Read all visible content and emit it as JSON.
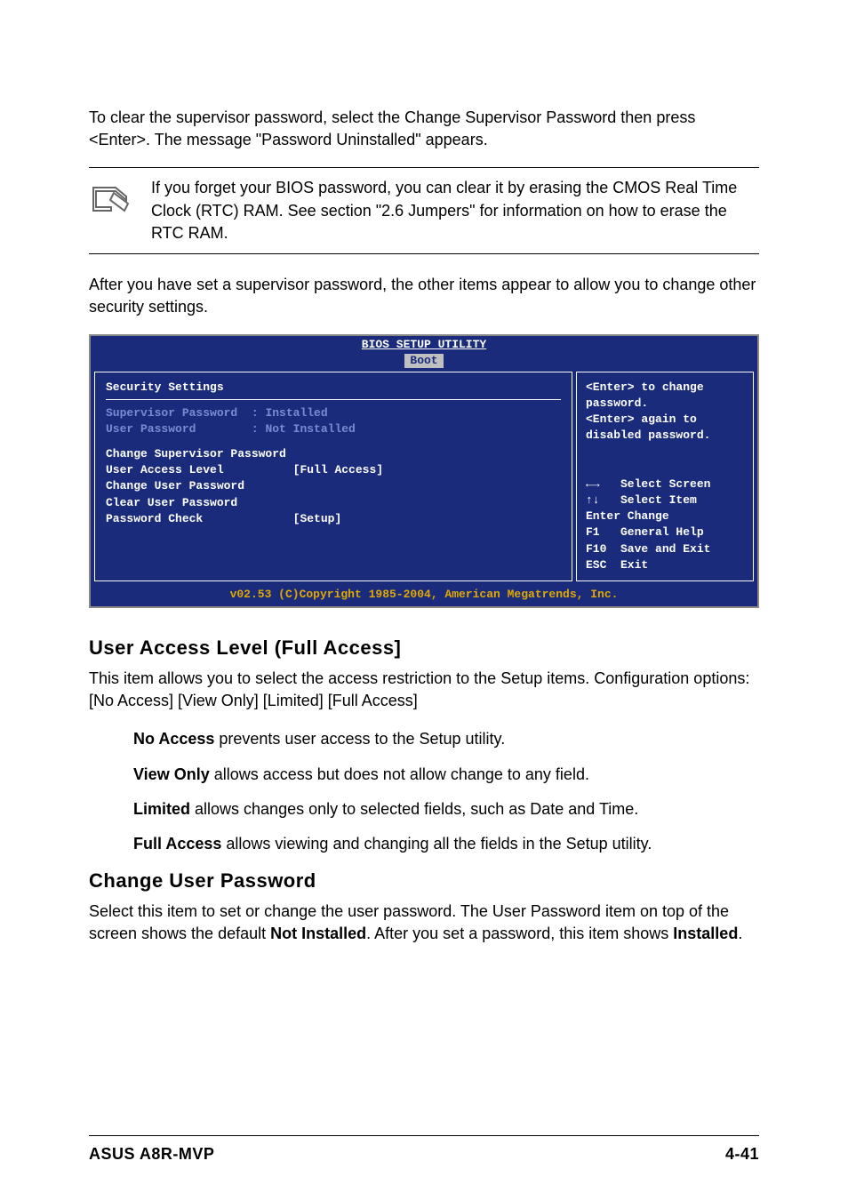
{
  "intro1": "To clear the supervisor password, select the Change Supervisor Password then press <Enter>. The message \"Password Uninstalled\" appears.",
  "note": "If you forget your BIOS password, you can clear it by erasing the CMOS Real Time Clock (RTC) RAM. See section \"2.6  Jumpers\" for information on how to erase the RTC RAM.",
  "intro2": "After you have set a supervisor password, the other items appear to allow you to change other security settings.",
  "bios": {
    "title": "BIOS SETUP UTILITY",
    "tab": "Boot",
    "left": {
      "heading": "Security Settings",
      "status1_label": "Supervisor Password",
      "status1_value": ": Installed",
      "status2_label": "User Password",
      "status2_value": ": Not Installed",
      "item1": "Change Supervisor Password",
      "item2_label": "User Access Level",
      "item2_value": "[Full Access]",
      "item3": "Change User Password",
      "item4": "Clear User Password",
      "item5_label": "Password Check",
      "item5_value": "[Setup]"
    },
    "right": {
      "help": "<Enter> to change\npassword.\n<Enter> again to\ndisabled password.",
      "nav": "←→   Select Screen\n↑↓   Select Item\nEnter Change\nF1   General Help\nF10  Save and Exit\nESC  Exit"
    },
    "footer": "v02.53 (C)Copyright 1985-2004, American Megatrends, Inc."
  },
  "ual": {
    "heading": "User Access Level (Full Access]",
    "desc": "This item allows you to select the access restriction to the Setup items. Configuration options: [No Access] [View Only] [Limited] [Full Access]",
    "opts": {
      "no_access_name": "No Access",
      "no_access_desc": " prevents user access to the Setup utility.",
      "view_only_name": "View Only",
      "view_only_desc": " allows access but does not allow change to any field.",
      "limited_name": "Limited",
      "limited_desc": " allows changes only to selected fields, such as Date and Time.",
      "full_access_name": "Full Access",
      "full_access_desc": " allows viewing and changing all the fields in the Setup utility."
    }
  },
  "cup": {
    "heading": "Change User Password",
    "desc_part1": "Select this item to set or change the user password. The User Password item on top of the screen shows the default ",
    "bold1": "Not Installed",
    "desc_part2": ". After you set a password, this item shows ",
    "bold2": "Installed",
    "desc_part3": "."
  },
  "footer": {
    "left": "ASUS A8R-MVP",
    "right": "4-41"
  }
}
